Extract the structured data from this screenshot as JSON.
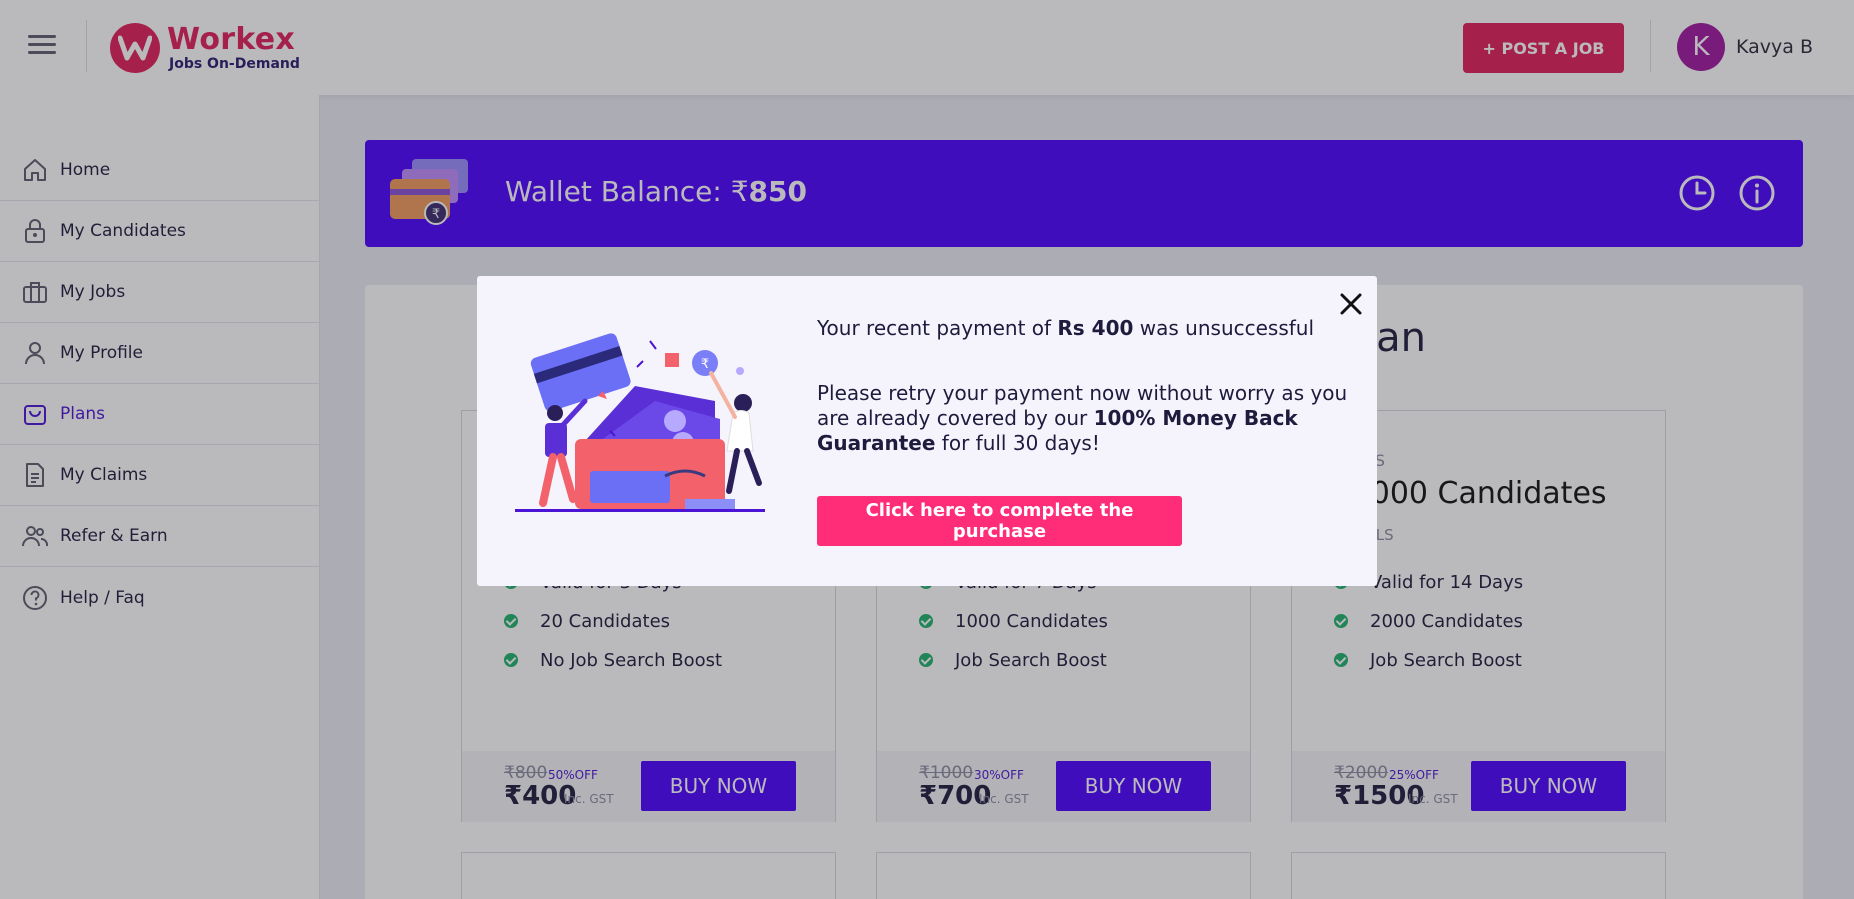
{
  "header": {
    "logo_name": "Workex",
    "logo_tagline": "Jobs On-Demand",
    "post_job_label": "+ POST A JOB",
    "avatar_initial": "K",
    "user_name": "Kavya B"
  },
  "sidebar": {
    "items": [
      {
        "label": "Home",
        "icon": "home-icon"
      },
      {
        "label": "My Candidates",
        "icon": "lock-icon"
      },
      {
        "label": "My Jobs",
        "icon": "briefcase-icon"
      },
      {
        "label": "My Profile",
        "icon": "user-icon"
      },
      {
        "label": "Plans",
        "icon": "shopping-bag-icon",
        "active": true
      },
      {
        "label": "My Claims",
        "icon": "document-icon"
      },
      {
        "label": "Refer & Earn",
        "icon": "users-icon"
      },
      {
        "label": "Help / Faq",
        "icon": "help-icon"
      }
    ]
  },
  "wallet": {
    "label": "Wallet Balance: ₹",
    "amount": "850"
  },
  "plans_title_fragment": "lan",
  "plans": [
    {
      "kicker": "",
      "title": "",
      "details": "",
      "features": [
        "Valid for 3 Days",
        "20 Candidates",
        "No Job Search Boost"
      ],
      "old_price": "₹800",
      "discount": "50%OFF",
      "price": "₹400",
      "gst": "Inc. GST",
      "buy_label": "BUY NOW"
    },
    {
      "kicker": "",
      "title": "",
      "details": "",
      "features": [
        "Valid for 7 Days",
        "1000 Candidates",
        "Job Search Boost"
      ],
      "old_price": "₹1000",
      "discount": "30%OFF",
      "price": "₹700",
      "gst": "Inc. GST",
      "buy_label": "BUY NOW"
    },
    {
      "kicker": "T JOBS",
      "title": ": 2000 Candidates",
      "details": "DETAILS",
      "features": [
        "Valid for 14 Days",
        "2000 Candidates",
        "Job Search Boost"
      ],
      "old_price": "₹2000",
      "discount": "25%OFF",
      "price": "₹1500",
      "gst": "Inc. GST",
      "buy_label": "BUY NOW"
    }
  ],
  "modal": {
    "line1_pre": "Your recent payment of ",
    "line1_amount": "Rs 400",
    "line1_post": " was unsuccessful",
    "line2_pre": "Please retry your payment now without worry as you are already covered by our ",
    "line2_bold": "100% Money Back Guarantee",
    "line2_post": " for full 30 days!",
    "cta_label": "Click here to complete the purchase",
    "close_icon": "close-icon"
  },
  "colors": {
    "brand_pink": "#e01e5a",
    "brand_purple": "#4b00ff",
    "success_green": "#20b26b"
  }
}
